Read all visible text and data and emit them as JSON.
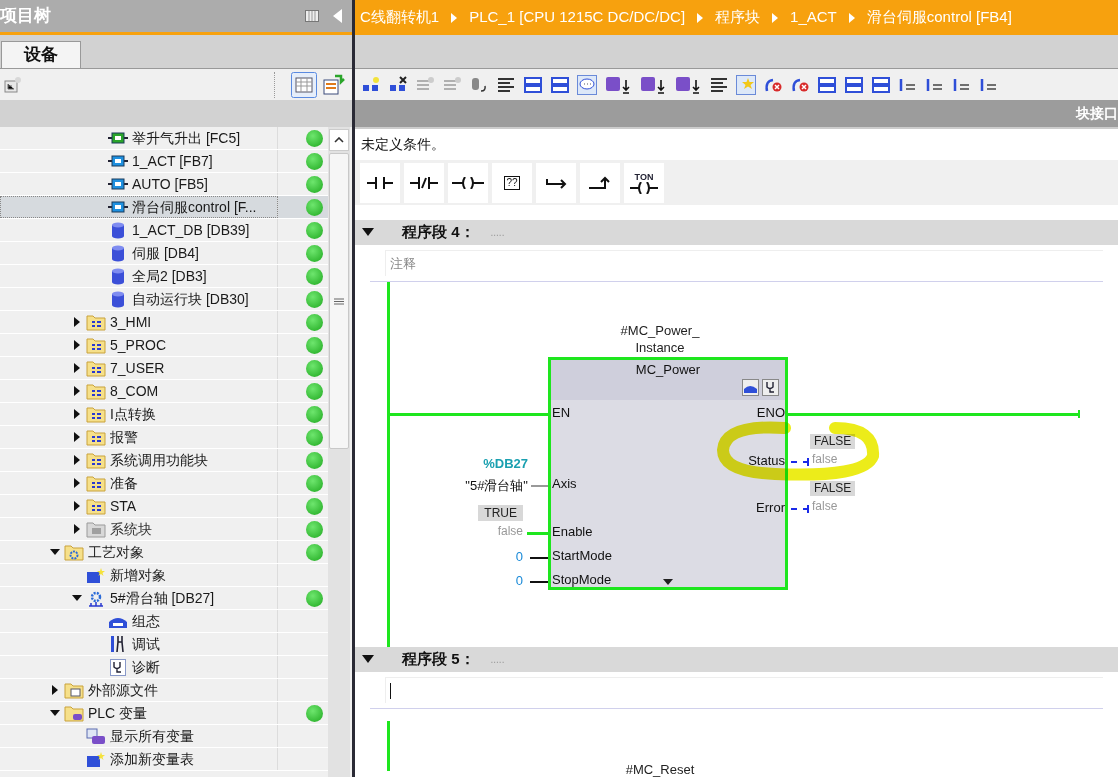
{
  "project_tree": {
    "title": "项目树",
    "tabs": [
      {
        "label": "设备",
        "selected": true
      }
    ],
    "continued_items": [
      {
        "label": "举升气升出 [FC5]",
        "kind": "fc",
        "status_ok": true,
        "selected": false
      },
      {
        "label": "1_ACT [FB7]",
        "kind": "fb",
        "status_ok": true,
        "selected": false
      },
      {
        "label": "AUTO [FB5]",
        "kind": "fb",
        "status_ok": true,
        "selected": false
      },
      {
        "label": "滑台伺服control [F...",
        "kind": "fb",
        "status_ok": true,
        "selected": true
      },
      {
        "label": "1_ACT_DB [DB39]",
        "kind": "db",
        "status_ok": true,
        "selected": false
      },
      {
        "label": "伺服 [DB4]",
        "kind": "db",
        "status_ok": true,
        "selected": false
      },
      {
        "label": "全局2 [DB3]",
        "kind": "db",
        "status_ok": true,
        "selected": false
      },
      {
        "label": "自动运行块 [DB30]",
        "kind": "db",
        "status_ok": true,
        "selected": false
      }
    ],
    "folders": [
      {
        "label": "3_HMI",
        "kind": "folder",
        "expanded": false,
        "status_ok": true,
        "selected": false
      },
      {
        "label": "5_PROC",
        "kind": "folder",
        "expanded": false,
        "status_ok": true,
        "selected": false
      },
      {
        "label": "7_USER",
        "kind": "folder",
        "expanded": false,
        "status_ok": true,
        "selected": false
      },
      {
        "label": "8_COM",
        "kind": "folder",
        "expanded": false,
        "status_ok": true,
        "selected": false
      },
      {
        "label": "I点转换",
        "kind": "folder",
        "expanded": false,
        "status_ok": true,
        "selected": false
      },
      {
        "label": "报警",
        "kind": "folder",
        "expanded": false,
        "status_ok": true,
        "selected": false
      },
      {
        "label": "系统调用功能块",
        "kind": "folder",
        "expanded": false,
        "status_ok": true,
        "selected": false
      },
      {
        "label": "准备",
        "kind": "folder",
        "expanded": false,
        "status_ok": true,
        "selected": false
      },
      {
        "label": "STA",
        "kind": "folder",
        "expanded": false,
        "status_ok": true,
        "selected": false
      },
      {
        "label": "系统块",
        "kind": "system_folder",
        "expanded": false,
        "status_ok": true,
        "selected": false
      }
    ],
    "items": [
      {
        "label": "工艺对象",
        "kind": "tech_folder",
        "expanded": true,
        "status_ok": true,
        "selected": false,
        "children": [
          {
            "label": "新增对象",
            "kind": "add",
            "status_ok": false,
            "selected": false
          },
          {
            "label": "5#滑台轴 [DB27]",
            "kind": "axis",
            "expanded": true,
            "status_ok": true,
            "selected": false,
            "children": [
              {
                "label": "组态",
                "kind": "config",
                "status_ok": false,
                "selected": false
              },
              {
                "label": "调试",
                "kind": "commission",
                "status_ok": false,
                "selected": false
              },
              {
                "label": "诊断",
                "kind": "diagnostics",
                "status_ok": false,
                "selected": false
              }
            ]
          }
        ]
      },
      {
        "label": "外部源文件",
        "kind": "source_folder",
        "expanded": false,
        "status_ok": false,
        "selected": false
      },
      {
        "label": "PLC 变量",
        "kind": "tag_folder",
        "expanded": true,
        "status_ok": true,
        "selected": false,
        "children": [
          {
            "label": "显示所有变量",
            "kind": "tags",
            "status_ok": false,
            "selected": false
          },
          {
            "label": "添加新变量表",
            "kind": "add",
            "status_ok": false,
            "selected": false
          }
        ]
      }
    ]
  },
  "editor": {
    "breadcrumb": [
      "C线翻转机1",
      "PLC_1 [CPU 1215C DC/DC/DC]",
      "程序块",
      "1_ACT",
      "滑台伺服control [FB4]"
    ],
    "interface_label": "块接口",
    "condition_text": "未定义条件。",
    "instructions": [
      {
        "kind": "contact"
      },
      {
        "kind": "negated_contact"
      },
      {
        "kind": "coil"
      },
      {
        "kind": "empty_box",
        "label": "??"
      },
      {
        "kind": "open_branch"
      },
      {
        "kind": "close_branch"
      },
      {
        "kind": "timer",
        "label": "TON"
      }
    ],
    "networks": [
      {
        "title": "程序段 4：",
        "dots": ".....",
        "expanded": true,
        "comment": {
          "placeholder": "注释"
        },
        "comment_focused": false,
        "block": {
          "instance_lines": [
            "#MC_Power_",
            "Instance"
          ],
          "name": "MC_Power",
          "powered": true,
          "inputs": [
            {
              "pin": "EN",
              "kind": "en"
            },
            {
              "pin": "Axis",
              "kind": "operand",
              "address": "%DB27",
              "operand": "\"5#滑台轴\""
            },
            {
              "pin": "Enable",
              "kind": "bool",
              "status": "TRUE",
              "value": "false"
            },
            {
              "pin": "StartMode",
              "kind": "int",
              "value": "0"
            },
            {
              "pin": "StopMode",
              "kind": "int",
              "value": "0"
            }
          ],
          "outputs": [
            {
              "pin": "ENO",
              "kind": "eno"
            },
            {
              "pin": "Status",
              "kind": "bool",
              "status": "FALSE",
              "value": "false"
            },
            {
              "pin": "Error",
              "kind": "bool",
              "status": "FALSE",
              "value": "false"
            }
          ]
        }
      },
      {
        "title": "程序段 5：",
        "dots": ".....",
        "expanded": true,
        "comment_focused": true,
        "block": {
          "instance_lines": [
            "#MC_Reset"
          ],
          "powered": true
        }
      }
    ]
  }
}
